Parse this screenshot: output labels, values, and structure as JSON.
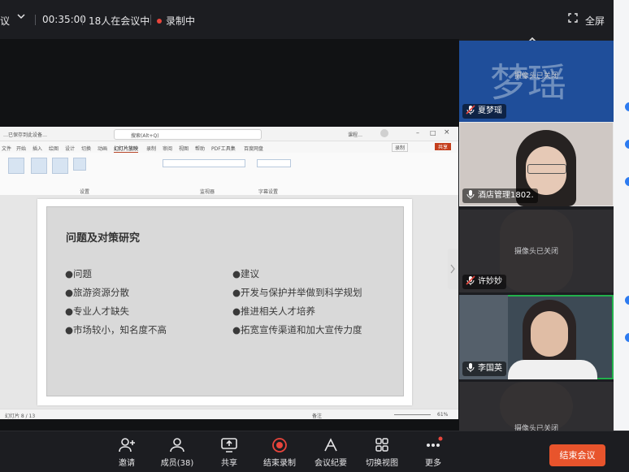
{
  "topbar": {
    "title_fragment": "议",
    "duration": "00:35:00",
    "participants": "18人在会议中",
    "recording": "录制中",
    "fullscreen_label": "全屏"
  },
  "ppt": {
    "window_title": "…已保存到此设备…",
    "search_placeholder": "搜索(Alt+Q)",
    "user_name": "课程…",
    "record_label": "录制",
    "share_label": "共享",
    "menu": [
      "文件",
      "开始",
      "插入",
      "绘图",
      "设计",
      "切换",
      "动画",
      "幻灯片放映",
      "录制",
      "审阅",
      "视图",
      "帮助",
      "PDF工具集",
      "百度网盘"
    ],
    "ribbon_groups": [
      "设置",
      "监视器",
      "字幕设置"
    ],
    "slide_title": "问题及对策研究",
    "left_bullets": [
      "●问题",
      "●旅游资源分散",
      "●专业人才缺失",
      "●市场较小，知名度不高"
    ],
    "right_bullets": [
      "●建议",
      "●开发与保护并举做到科学规划",
      "●推进相关人才培养",
      "●拓宽宣传渠道和加大宣传力度"
    ],
    "status_left": "幻灯片 8 / 13",
    "status_notes": "备注",
    "status_zoom": "61%"
  },
  "participants_panel": {
    "tiles": [
      {
        "name": "夏梦瑶",
        "avatar_text": "梦瑶",
        "camera_off": "摄像头已关闭",
        "mic_muted": true
      },
      {
        "name": "酒店管理1802.",
        "camera_off": "",
        "mic_muted": false
      },
      {
        "name": "许妙妙",
        "camera_off": "摄像头已关闭",
        "mic_muted": true
      },
      {
        "name": "李国英",
        "camera_off": "",
        "mic_muted": false
      },
      {
        "name": "",
        "camera_off": "摄像头已关闭",
        "mic_muted": true
      }
    ]
  },
  "toolbar": {
    "invite": "邀请",
    "members": "成员(38)",
    "share": "共享",
    "end_record": "结束录制",
    "minutes": "会议纪要",
    "switch_view": "切换视图",
    "more": "更多",
    "end_meeting": "结束会议"
  },
  "colors": {
    "accent_red": "#e8542c",
    "active_speaker": "#22b14c",
    "avatar_bg": "#1f4e9a"
  }
}
